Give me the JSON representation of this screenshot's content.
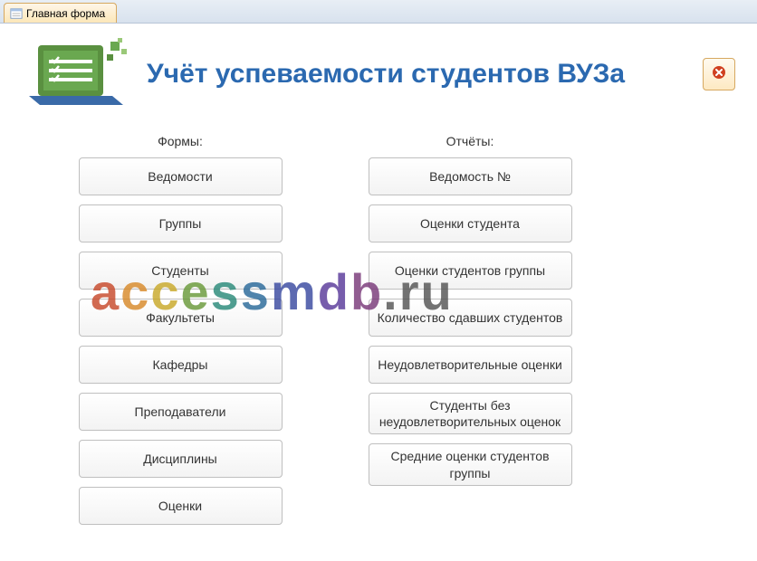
{
  "tab": {
    "label": "Главная форма"
  },
  "header": {
    "title": "Учёт успеваемости студентов ВУЗа"
  },
  "forms": {
    "heading": "Формы:",
    "buttons": [
      "Ведомости",
      "Группы",
      "Студенты",
      "Факультеты",
      "Кафедры",
      "Преподаватели",
      "Дисциплины",
      "Оценки"
    ]
  },
  "reports": {
    "heading": "Отчёты:",
    "buttons": [
      "Ведомость №",
      "Оценки студента",
      "Оценки студентов группы",
      "Количество сдавших студентов",
      "Неудовлетворительные оценки",
      "Студенты без неудовлетворительных оценок",
      "Средние оценки студентов группы"
    ]
  },
  "watermark": "accessmdb.ru"
}
